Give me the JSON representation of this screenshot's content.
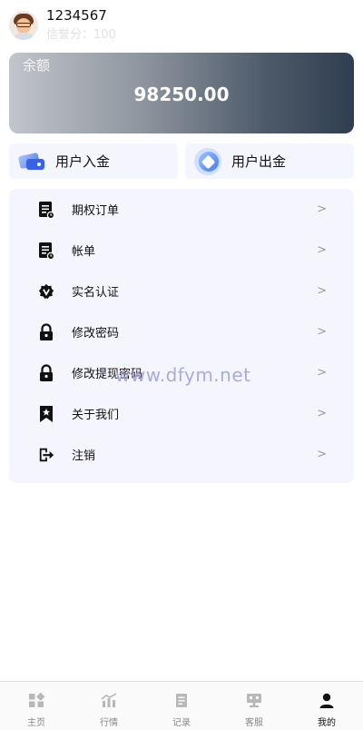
{
  "user": {
    "name": "1234567",
    "credit": "信誉分：100"
  },
  "balance": {
    "label": "余额",
    "value": "98250.00"
  },
  "actions": {
    "deposit_label": "用户入金",
    "withdraw_label": "用户出金"
  },
  "menu": {
    "items": [
      {
        "label": "期权订单",
        "arrow": ">",
        "icon": "order-doc-icon"
      },
      {
        "label": "帐单",
        "arrow": ">",
        "icon": "bill-doc-icon"
      },
      {
        "label": "实名认证",
        "arrow": ">",
        "icon": "verified-badge-icon"
      },
      {
        "label": "修改密码",
        "arrow": ">",
        "icon": "lock-icon"
      },
      {
        "label": "修改提现密码",
        "arrow": ">",
        "icon": "lock-icon"
      },
      {
        "label": "关于我们",
        "arrow": ">",
        "icon": "bookmark-star-icon"
      },
      {
        "label": "注销",
        "arrow": ">",
        "icon": "logout-icon"
      }
    ]
  },
  "watermark": "www.dfym.net",
  "tabbar": {
    "tabs": [
      {
        "label": "主页",
        "icon": "home-grid-icon",
        "active": false
      },
      {
        "label": "行情",
        "icon": "market-chart-icon",
        "active": false
      },
      {
        "label": "记录",
        "icon": "records-icon",
        "active": false
      },
      {
        "label": "客服",
        "icon": "customer-service-icon",
        "active": false
      },
      {
        "label": "我的",
        "icon": "profile-icon",
        "active": true
      }
    ]
  },
  "colors": {
    "panel_bg": "#f5f5fd",
    "card_gradient_start": "#c2c5ca",
    "card_gradient_end": "#2f3e50",
    "accent_blue": "#3f7cf2"
  }
}
